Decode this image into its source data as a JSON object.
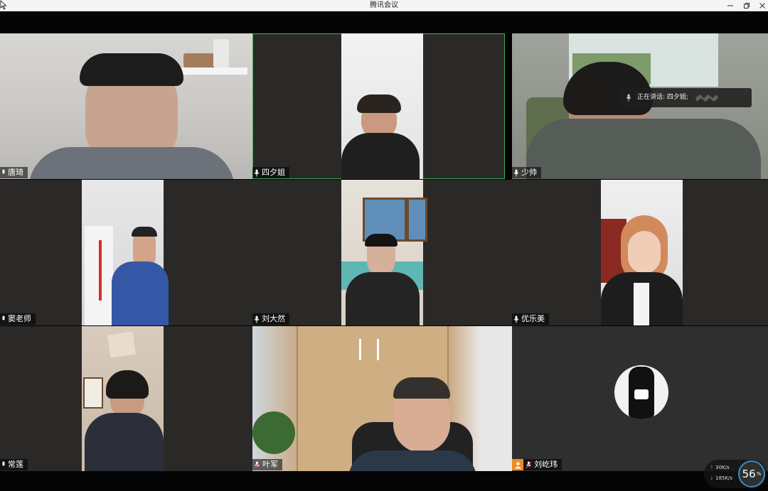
{
  "window": {
    "title": "腾讯会议"
  },
  "speaker_toast": {
    "label": "正在讲话: 四夕姐;"
  },
  "participants": [
    {
      "name": "唐琦",
      "mic": "on"
    },
    {
      "name": "四夕姐",
      "mic": "on"
    },
    {
      "name": "少帅",
      "mic": "on"
    },
    {
      "name": "窦老师",
      "mic": "on"
    },
    {
      "name": "刘大然",
      "mic": "on"
    },
    {
      "name": "优乐美",
      "mic": "on"
    },
    {
      "name": "常莲",
      "mic": "on"
    },
    {
      "name": "叶军",
      "mic": "muted"
    },
    {
      "name": "刘屹玮",
      "mic": "muted",
      "video": "off",
      "host_badge": true
    }
  ],
  "network": {
    "upload": "30K/s",
    "download": "185K/s",
    "quality_value": "56",
    "quality_unit": "%"
  },
  "colors": {
    "active_speaker_border": "#3cb059",
    "tile_bg": "#2b2927",
    "host_badge": "#f08a24"
  }
}
